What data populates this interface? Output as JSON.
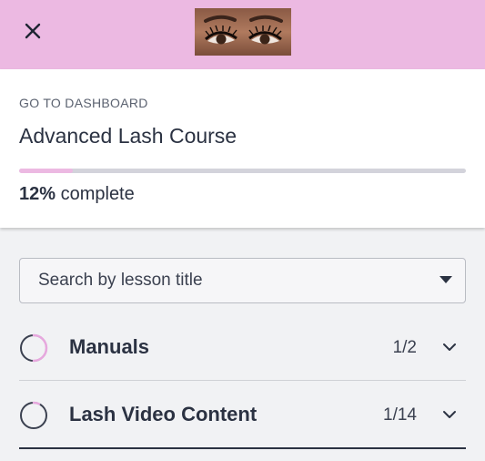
{
  "header": {
    "close_icon": "close-icon",
    "logo_image": "eyes-lashes-photo"
  },
  "course": {
    "dashboard_link": "GO TO DASHBOARD",
    "title": "Advanced Lash Course",
    "progress_percent": 12,
    "progress_value": "12%",
    "progress_suffix": " complete"
  },
  "search": {
    "placeholder": "Search by lesson title",
    "icon": "caret-down-icon"
  },
  "sections": [
    {
      "name": "Manuals",
      "count": "1/2",
      "progress_fraction": 0.5
    },
    {
      "name": "Lash Video Content",
      "count": "1/14",
      "progress_fraction": 0.07
    }
  ],
  "colors": {
    "accent": "#ecb9e2",
    "text": "#2b3242",
    "background": "#f1f2f4",
    "track": "#d3d3db"
  }
}
